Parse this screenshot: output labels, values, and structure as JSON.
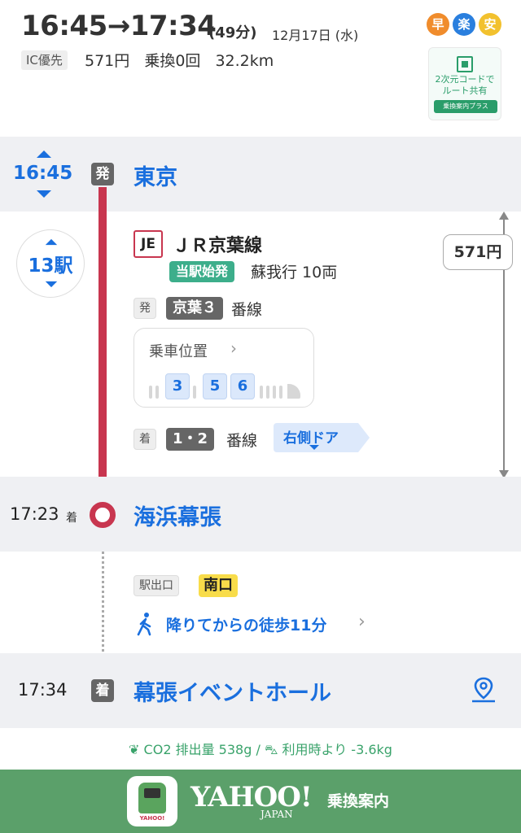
{
  "header": {
    "time_range": "16:45→17:34",
    "duration": "(49分)",
    "date": "12月17日 (水)",
    "ic_label": "IC優先",
    "fare": "571円",
    "transfers": "乗換0回",
    "distance": "32.2km",
    "badges": [
      {
        "label": "早",
        "color": "#f08c2c"
      },
      {
        "label": "楽",
        "color": "#2a7fde"
      },
      {
        "label": "安",
        "color": "#f2c12e"
      }
    ],
    "qr_text_1": "2次元コードで",
    "qr_text_2": "ルート共有",
    "qr_tag": "乗換案内プラス"
  },
  "departure": {
    "time": "16:45",
    "badge": "発",
    "station": "東京"
  },
  "ride": {
    "stops": "13駅",
    "line_code": "JE",
    "line_name": "ＪＲ京葉線",
    "origin_badge": "当駅始発",
    "destination": "蘇我行 10両",
    "dep_label": "発",
    "dep_track": "京葉３",
    "track_suffix": "番線",
    "car_position_title": "乗車位置",
    "cars": [
      "3",
      "5",
      "6"
    ],
    "arr_label": "着",
    "arr_track": "1・2",
    "door": "右側ドア",
    "fare": "571円"
  },
  "transfer_stop": {
    "time": "17:23",
    "suffix": "着",
    "station": "海浜幕張"
  },
  "walk": {
    "exit_label": "駅出口",
    "exit_name": "南口",
    "text": "降りてからの徒歩11分"
  },
  "arrival": {
    "time": "17:34",
    "badge": "着",
    "station": "幕張イベントホール"
  },
  "footer": {
    "co2": "CO2 排出量 538g /",
    "car_comparison": "利用時より -3.6kg",
    "app_label": "YAHOO!",
    "brand": "YAHOO!",
    "brand_sub": "JAPAN",
    "service": "乗換案内"
  },
  "colors": {
    "accent": "#1a6fde",
    "route_line": "#c8364f",
    "green": "#3dae8b",
    "footer": "#5ba06a"
  }
}
